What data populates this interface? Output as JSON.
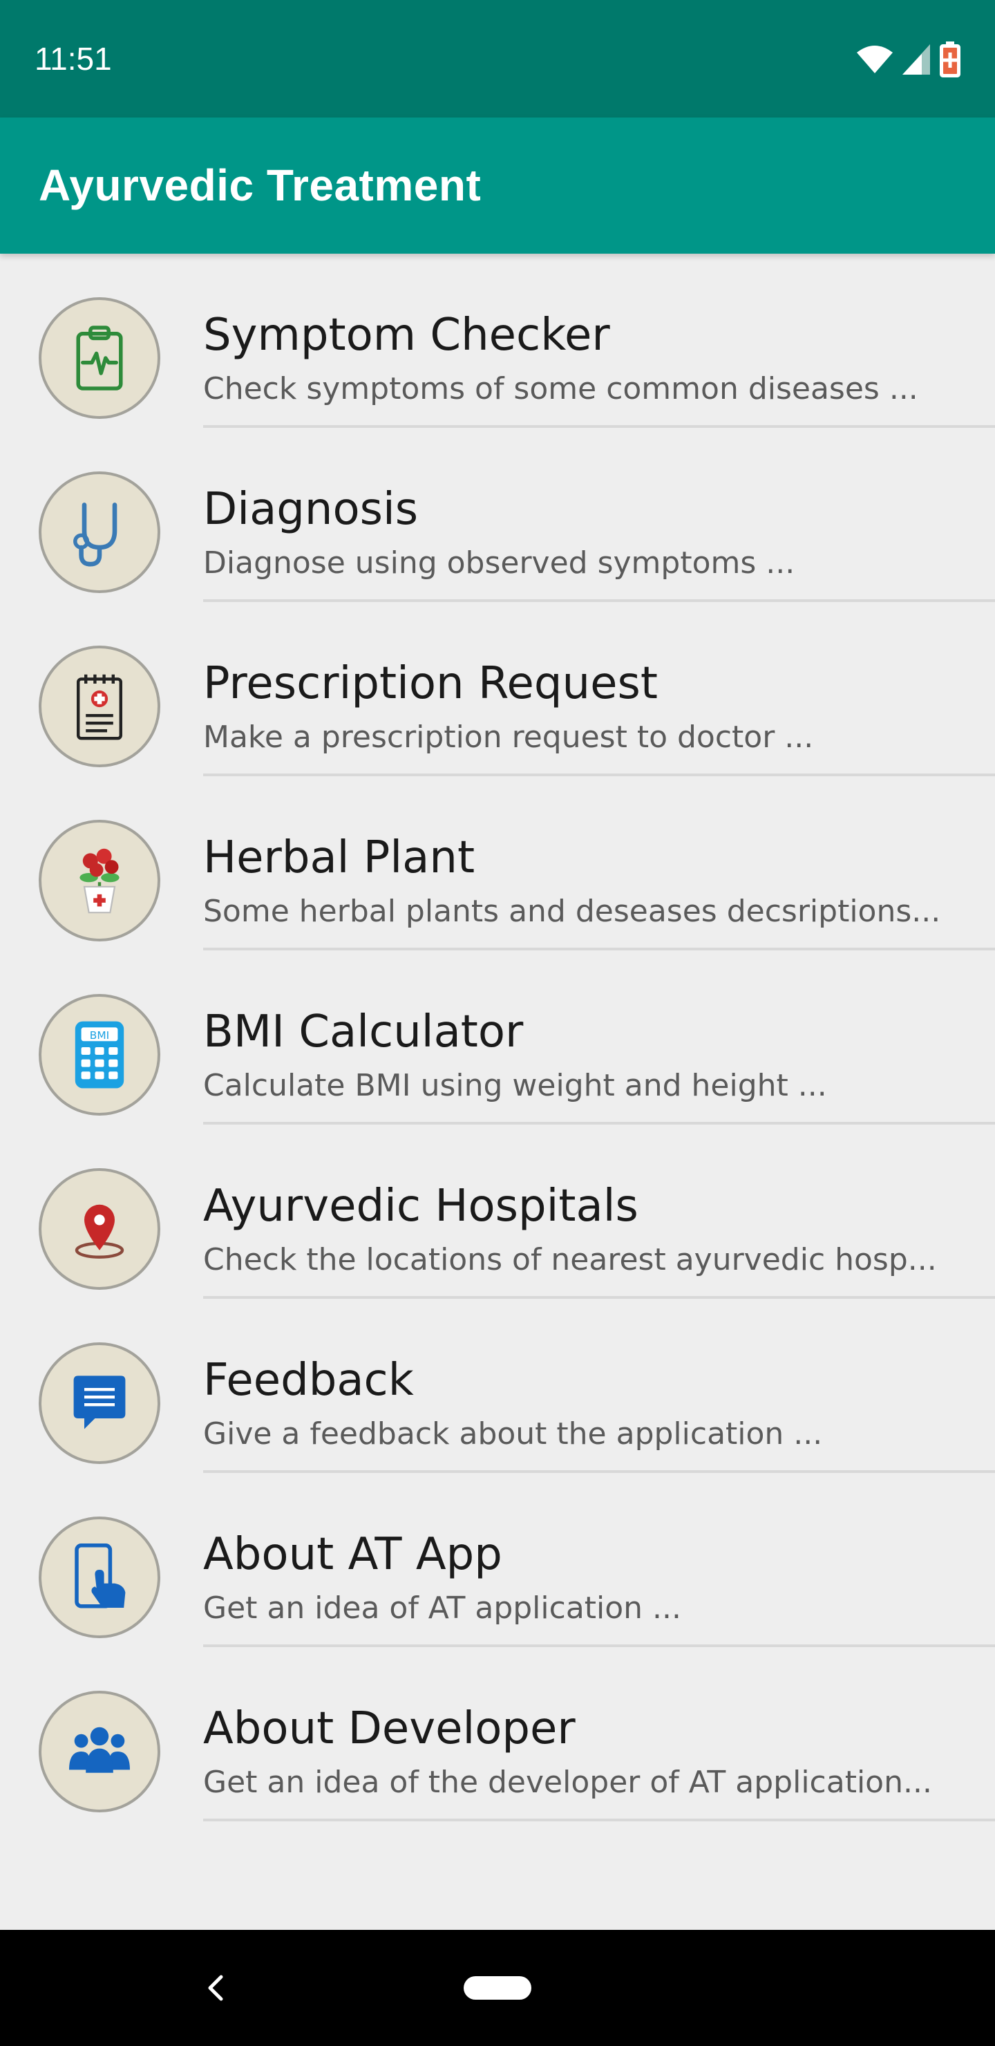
{
  "status_bar": {
    "time": "11:51",
    "icons": [
      "wifi-icon",
      "cell-signal-icon",
      "battery-charging-icon"
    ]
  },
  "app_bar": {
    "title": "Ayurvedic Treatment"
  },
  "menu": {
    "items": [
      {
        "title": "Symptom Checker",
        "description": "Check symptoms of some common diseases ...",
        "icon": "clipboard-heartbeat-icon"
      },
      {
        "title": "Diagnosis",
        "description": "Diagnose using observed symptoms ...",
        "icon": "stethoscope-icon"
      },
      {
        "title": "Prescription Request",
        "description": "Make a prescription request to doctor ...",
        "icon": "prescription-notepad-icon"
      },
      {
        "title": "Herbal Plant",
        "description": "Some herbal plants and deseases decsriptions...",
        "icon": "potted-plant-icon"
      },
      {
        "title": "BMI Calculator",
        "description": "Calculate BMI using weight and height ...",
        "icon": "bmi-calculator-icon"
      },
      {
        "title": "Ayurvedic Hospitals",
        "description": "Check the locations of nearest ayurvedic hosp...",
        "icon": "map-pin-icon"
      },
      {
        "title": "Feedback",
        "description": "Give a feedback about the application ...",
        "icon": "chat-bubble-icon"
      },
      {
        "title": "About AT App",
        "description": "Get an idea of AT application ...",
        "icon": "tap-phone-icon"
      },
      {
        "title": "About Developer",
        "description": "Get an idea of the developer of AT application...",
        "icon": "group-people-icon"
      }
    ]
  },
  "nav_bar": {
    "icons": [
      "back-icon",
      "home-pill-icon"
    ]
  },
  "colors": {
    "status_bar": "#00796b",
    "app_bar": "#009688",
    "background": "#eeeeee",
    "icon_circle": "#e6e1d0",
    "icon_border": "#a3a29b",
    "title_text": "#1a1a1a",
    "desc_text": "#5a5a5a",
    "divider": "#d8d8d8"
  }
}
